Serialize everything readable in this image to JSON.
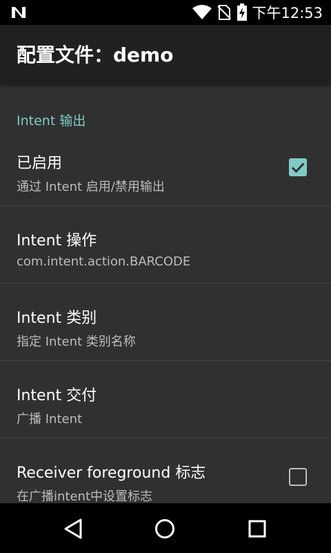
{
  "status_bar": {
    "time": "下午12:53",
    "icons": [
      "n-logo-icon",
      "wifi-icon",
      "no-sim-icon",
      "battery-charging-icon"
    ]
  },
  "app_bar": {
    "title": "配置文件：demo"
  },
  "category": {
    "label": "Intent 输出"
  },
  "preferences": [
    {
      "title": "已启用",
      "summary": "通过 Intent 启用/禁用输出",
      "checkbox": true,
      "checked": true
    },
    {
      "title": "Intent 操作",
      "summary": "com.intent.action.BARCODE"
    },
    {
      "title": "Intent 类别",
      "summary": "指定 Intent 类别名称"
    },
    {
      "title": "Intent 交付",
      "summary": "广播 Intent"
    },
    {
      "title": "Receiver foreground 标志",
      "summary": "在广播intent中设置标志",
      "checkbox": true,
      "checked": false
    }
  ],
  "nav_bar": {
    "icons": [
      "back-icon",
      "home-icon",
      "recents-icon"
    ]
  },
  "colors": {
    "accent": "#80cbc4",
    "background": "#303030",
    "app_bar": "#212121"
  }
}
